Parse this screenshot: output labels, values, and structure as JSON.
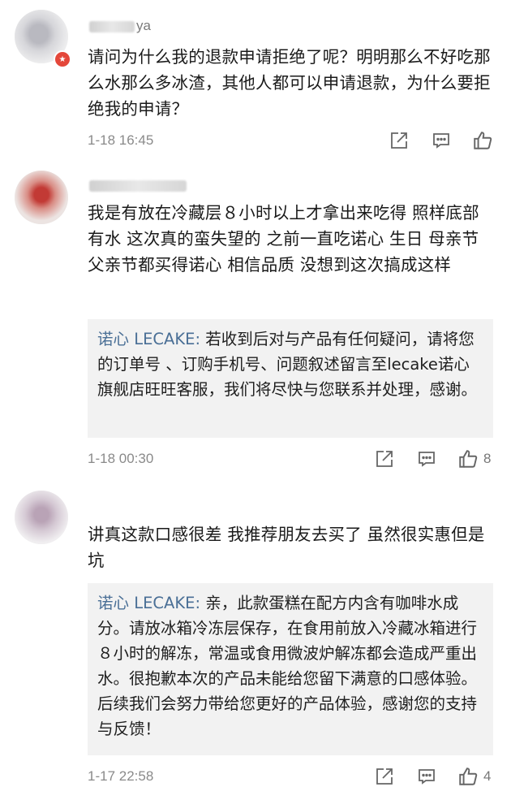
{
  "comments": [
    {
      "username": "ya",
      "text": "请问为什么我的退款申请拒绝了呢？明明那么不好吃那么水那么多冰渣，其他人都可以申请退款，为什么要拒绝我的申请？",
      "time": "1-18 16:45",
      "likes": ""
    },
    {
      "username": "",
      "text": "我是有放在冷藏层８小时以上才拿出来吃得 照样底部有水 这次真的蛮失望的 之前一直吃诺心 生日 母亲节 父亲节都买得诺心 相信品质 没想到这次搞成这样",
      "reply_author": "诺心 LECAKE:",
      "reply_text": " 若收到后对与产品有任何疑问，请将您的订单号 、订购手机号、问题叙述留言至lecake诺心旗舰店旺旺客服，我们将尽快与您联系并处理，感谢。",
      "time": "1-18 00:30",
      "likes": "8"
    },
    {
      "username": "",
      "text": "讲真这款口感很差 我推荐朋友去买了 虽然很实惠但是坑",
      "reply_author": "诺心 LECAKE:",
      "reply_text": " 亲，此款蛋糕在配方内含有咖啡水成分。请放冰箱冷冻层保存，在食用前放入冷藏冰箱进行８小时的解冻，常温或食用微波炉解冻都会造成严重出水。很抱歉本次的产品未能给您留下满意的口感体验。后续我们会努力带给您更好的产品体验，感谢您的支持与反馈！",
      "time": "1-17 22:58",
      "likes": "4"
    }
  ],
  "icons": {
    "share": "share-icon",
    "comment": "comment-icon",
    "like": "thumbs-up-icon"
  }
}
